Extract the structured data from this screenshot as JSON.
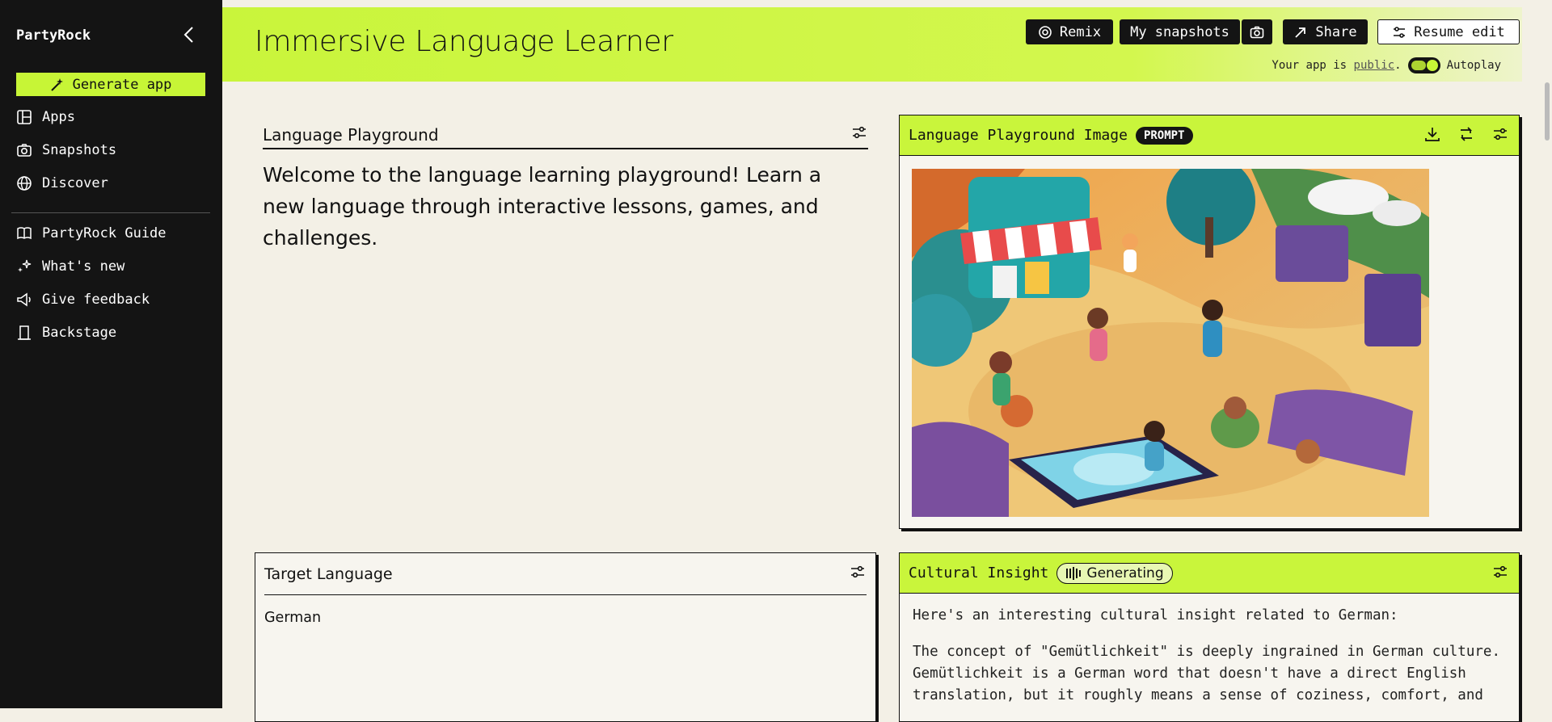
{
  "sidebar": {
    "logo": "PartyRock",
    "generate_label": "Generate app",
    "items_primary": [
      {
        "label": "Apps",
        "icon": "grid-icon"
      },
      {
        "label": "Snapshots",
        "icon": "camera-icon"
      },
      {
        "label": "Discover",
        "icon": "globe-icon"
      }
    ],
    "items_secondary": [
      {
        "label": "PartyRock Guide",
        "icon": "book-icon"
      },
      {
        "label": "What's new",
        "icon": "sparkle-icon"
      },
      {
        "label": "Give feedback",
        "icon": "megaphone-icon"
      },
      {
        "label": "Backstage",
        "icon": "door-icon"
      }
    ]
  },
  "header": {
    "title": "Immersive Language Learner",
    "remix_label": "Remix",
    "snapshots_label": "My snapshots",
    "share_label": "Share",
    "resume_label": "Resume edit",
    "public_prefix": "Your app is",
    "public_link": "public",
    "public_suffix": ".",
    "autoplay_label": "Autoplay",
    "autoplay_on": true,
    "accent_color": "#c9f53b"
  },
  "widgets": {
    "playground": {
      "title": "Language Playground",
      "text": "Welcome to the language learning playground! Learn a new language through interactive lessons, games, and challenges."
    },
    "image": {
      "title": "Language Playground Image",
      "badge": "PROMPT"
    },
    "target": {
      "title": "Target Language",
      "value": "German"
    },
    "insight": {
      "title": "Cultural Insight",
      "status": "Generating",
      "line1": "Here's an interesting cultural insight related to German:",
      "para": [
        "The concept of \"Gemütlichkeit\" is deeply ingrained in German culture.",
        "Gemütlichkeit is a German word that doesn't have a direct English",
        "translation, but it roughly means a sense of coziness, comfort, and"
      ]
    }
  }
}
